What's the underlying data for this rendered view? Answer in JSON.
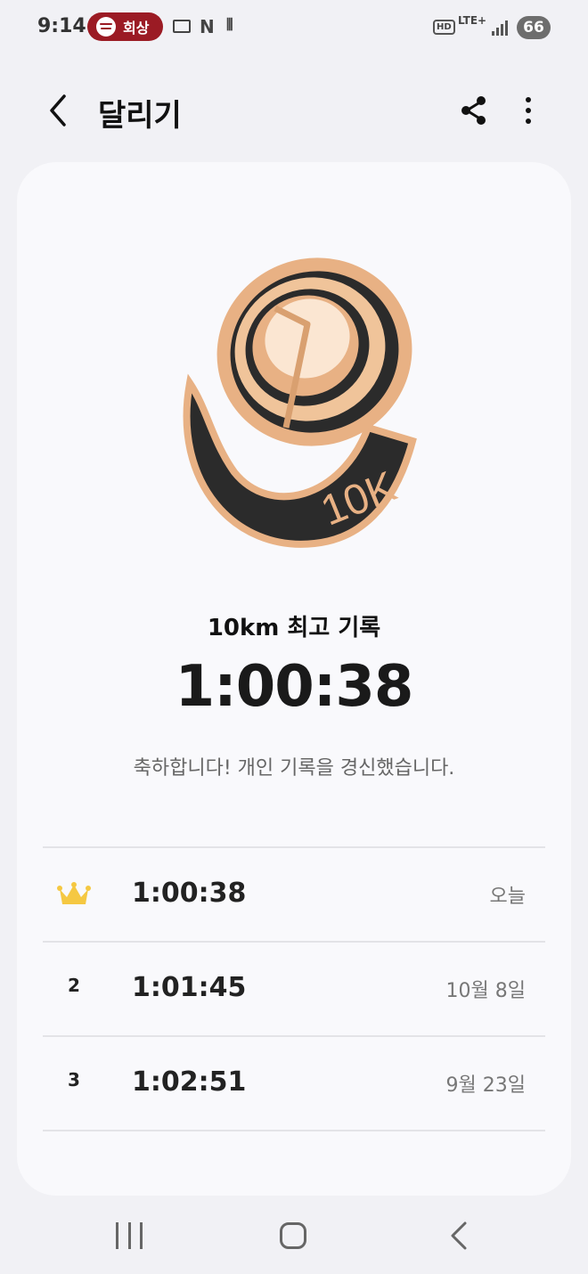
{
  "status_bar": {
    "time": "9:14",
    "media_pill_label": "회상",
    "n_label": "N",
    "hd_label": "HD",
    "lte_label": "LTE+",
    "battery": "66",
    "pill_color": "#9b1b24"
  },
  "app_bar": {
    "title": "달리기"
  },
  "medal": {
    "label": "10K",
    "gold": "#e8b184",
    "dark": "#2b2b2b"
  },
  "summary": {
    "label": "10km 최고 기록",
    "best_time": "1:00:38",
    "message": "축하합니다! 개인 기록을 경신했습니다."
  },
  "records": [
    {
      "rank": "1",
      "icon": "crown-icon",
      "time": "1:00:38",
      "date": "오늘"
    },
    {
      "rank": "2",
      "time": "1:01:45",
      "date": "10월 8일"
    },
    {
      "rank": "3",
      "time": "1:02:51",
      "date": "9월 23일"
    }
  ]
}
